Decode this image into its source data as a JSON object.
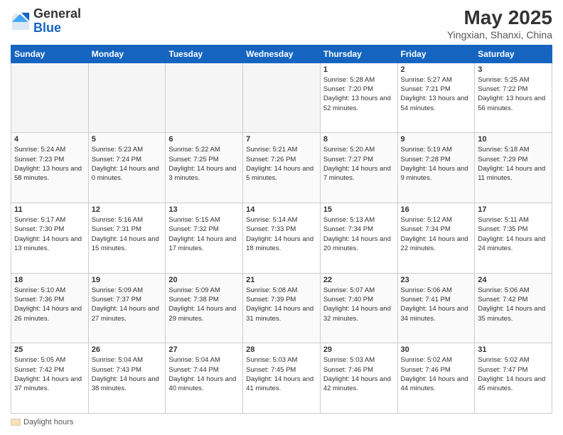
{
  "header": {
    "logo_general": "General",
    "logo_blue": "Blue",
    "month_title": "May 2025",
    "location": "Yingxian, Shanxi, China"
  },
  "weekdays": [
    "Sunday",
    "Monday",
    "Tuesday",
    "Wednesday",
    "Thursday",
    "Friday",
    "Saturday"
  ],
  "legend": {
    "label": "Daylight hours"
  },
  "weeks": [
    [
      {
        "day": "",
        "empty": true
      },
      {
        "day": "",
        "empty": true
      },
      {
        "day": "",
        "empty": true
      },
      {
        "day": "",
        "empty": true
      },
      {
        "day": "1",
        "sunrise": "5:28 AM",
        "sunset": "7:20 PM",
        "daylight": "13 hours and 52 minutes."
      },
      {
        "day": "2",
        "sunrise": "5:27 AM",
        "sunset": "7:21 PM",
        "daylight": "13 hours and 54 minutes."
      },
      {
        "day": "3",
        "sunrise": "5:25 AM",
        "sunset": "7:22 PM",
        "daylight": "13 hours and 56 minutes."
      }
    ],
    [
      {
        "day": "4",
        "sunrise": "5:24 AM",
        "sunset": "7:23 PM",
        "daylight": "13 hours and 58 minutes."
      },
      {
        "day": "5",
        "sunrise": "5:23 AM",
        "sunset": "7:24 PM",
        "daylight": "14 hours and 0 minutes."
      },
      {
        "day": "6",
        "sunrise": "5:22 AM",
        "sunset": "7:25 PM",
        "daylight": "14 hours and 3 minutes."
      },
      {
        "day": "7",
        "sunrise": "5:21 AM",
        "sunset": "7:26 PM",
        "daylight": "14 hours and 5 minutes."
      },
      {
        "day": "8",
        "sunrise": "5:20 AM",
        "sunset": "7:27 PM",
        "daylight": "14 hours and 7 minutes."
      },
      {
        "day": "9",
        "sunrise": "5:19 AM",
        "sunset": "7:28 PM",
        "daylight": "14 hours and 9 minutes."
      },
      {
        "day": "10",
        "sunrise": "5:18 AM",
        "sunset": "7:29 PM",
        "daylight": "14 hours and 11 minutes."
      }
    ],
    [
      {
        "day": "11",
        "sunrise": "5:17 AM",
        "sunset": "7:30 PM",
        "daylight": "14 hours and 13 minutes."
      },
      {
        "day": "12",
        "sunrise": "5:16 AM",
        "sunset": "7:31 PM",
        "daylight": "14 hours and 15 minutes."
      },
      {
        "day": "13",
        "sunrise": "5:15 AM",
        "sunset": "7:32 PM",
        "daylight": "14 hours and 17 minutes."
      },
      {
        "day": "14",
        "sunrise": "5:14 AM",
        "sunset": "7:33 PM",
        "daylight": "14 hours and 18 minutes."
      },
      {
        "day": "15",
        "sunrise": "5:13 AM",
        "sunset": "7:34 PM",
        "daylight": "14 hours and 20 minutes."
      },
      {
        "day": "16",
        "sunrise": "5:12 AM",
        "sunset": "7:34 PM",
        "daylight": "14 hours and 22 minutes."
      },
      {
        "day": "17",
        "sunrise": "5:11 AM",
        "sunset": "7:35 PM",
        "daylight": "14 hours and 24 minutes."
      }
    ],
    [
      {
        "day": "18",
        "sunrise": "5:10 AM",
        "sunset": "7:36 PM",
        "daylight": "14 hours and 26 minutes."
      },
      {
        "day": "19",
        "sunrise": "5:09 AM",
        "sunset": "7:37 PM",
        "daylight": "14 hours and 27 minutes."
      },
      {
        "day": "20",
        "sunrise": "5:09 AM",
        "sunset": "7:38 PM",
        "daylight": "14 hours and 29 minutes."
      },
      {
        "day": "21",
        "sunrise": "5:08 AM",
        "sunset": "7:39 PM",
        "daylight": "14 hours and 31 minutes."
      },
      {
        "day": "22",
        "sunrise": "5:07 AM",
        "sunset": "7:40 PM",
        "daylight": "14 hours and 32 minutes."
      },
      {
        "day": "23",
        "sunrise": "5:06 AM",
        "sunset": "7:41 PM",
        "daylight": "14 hours and 34 minutes."
      },
      {
        "day": "24",
        "sunrise": "5:06 AM",
        "sunset": "7:42 PM",
        "daylight": "14 hours and 35 minutes."
      }
    ],
    [
      {
        "day": "25",
        "sunrise": "5:05 AM",
        "sunset": "7:42 PM",
        "daylight": "14 hours and 37 minutes."
      },
      {
        "day": "26",
        "sunrise": "5:04 AM",
        "sunset": "7:43 PM",
        "daylight": "14 hours and 38 minutes."
      },
      {
        "day": "27",
        "sunrise": "5:04 AM",
        "sunset": "7:44 PM",
        "daylight": "14 hours and 40 minutes."
      },
      {
        "day": "28",
        "sunrise": "5:03 AM",
        "sunset": "7:45 PM",
        "daylight": "14 hours and 41 minutes."
      },
      {
        "day": "29",
        "sunrise": "5:03 AM",
        "sunset": "7:46 PM",
        "daylight": "14 hours and 42 minutes."
      },
      {
        "day": "30",
        "sunrise": "5:02 AM",
        "sunset": "7:46 PM",
        "daylight": "14 hours and 44 minutes."
      },
      {
        "day": "31",
        "sunrise": "5:02 AM",
        "sunset": "7:47 PM",
        "daylight": "14 hours and 45 minutes."
      }
    ]
  ]
}
